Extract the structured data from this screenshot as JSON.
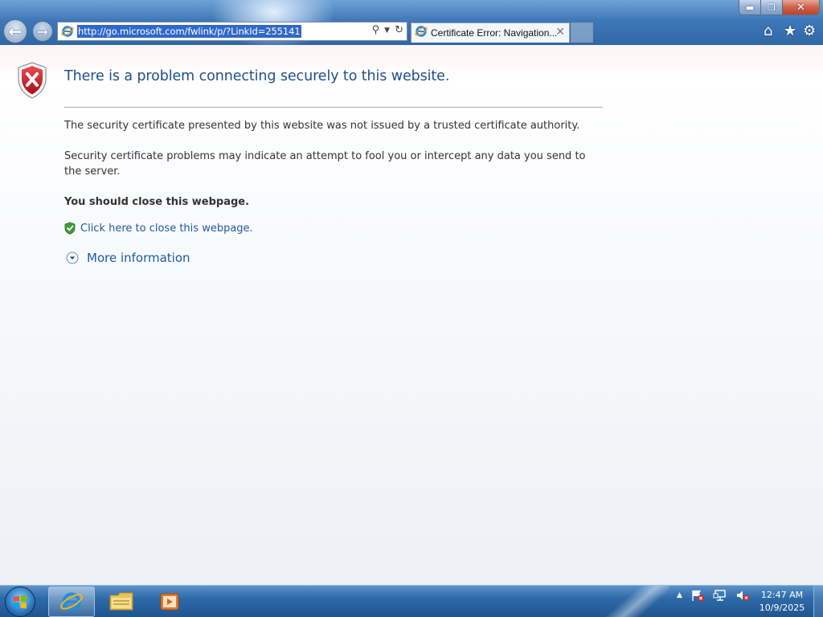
{
  "browser": {
    "address_url": "http://go.microsoft.com/fwlink/p/?LinkId=255141",
    "tab_title": "Certificate Error: Navigation...",
    "icons": {
      "back": "back-arrow-icon",
      "forward": "forward-arrow-icon",
      "search": "search-icon",
      "dropdown": "chevron-down-icon",
      "refresh": "refresh-icon",
      "home": "home-icon",
      "favorites": "star-icon",
      "tools": "gear-icon",
      "close_tab": "close-icon"
    }
  },
  "window_controls": {
    "minimize": "minimize-icon",
    "maximize": "restore-icon",
    "close": "close-icon"
  },
  "page": {
    "title": "There is a problem connecting securely to this website.",
    "paragraph1": "The security certificate presented by this website was not issued by a trusted certificate authority.",
    "paragraph2": "Security certificate problems may indicate an attempt to fool you or intercept any data you send to the server.",
    "recommendation": "You should close this webpage.",
    "close_link": "Click here to close this webpage.",
    "more_info": "More information"
  },
  "taskbar": {
    "time": "12:47 AM",
    "date": "10/9/2025",
    "apps": [
      "internet-explorer",
      "file-explorer",
      "media-player"
    ]
  },
  "colors": {
    "title_blue": "#1f4e8c",
    "link_blue": "#1e5aa0",
    "shield_red": "#c8202a",
    "url_selection": "#3068c8"
  }
}
